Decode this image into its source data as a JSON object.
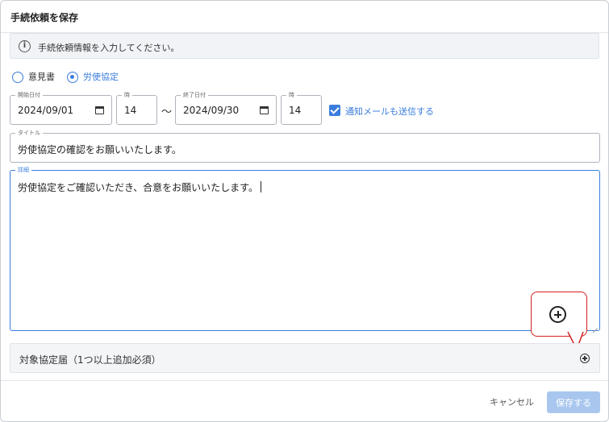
{
  "dialog": {
    "title": "手続依頼を保存",
    "info_text": "手続依頼情報を入力してください。"
  },
  "radios": [
    {
      "label": "意見書",
      "selected": false
    },
    {
      "label": "労使協定",
      "selected": true
    }
  ],
  "start_date": {
    "legend": "開始日付",
    "value": "2024/09/01"
  },
  "start_hour": {
    "legend": "時",
    "value": "14"
  },
  "separator": "～",
  "end_date": {
    "legend": "終了日付",
    "value": "2024/09/30"
  },
  "end_hour": {
    "legend": "時",
    "value": "14"
  },
  "notify": {
    "label": "通知メールも送信する",
    "checked": true
  },
  "title_field": {
    "legend": "タイトル",
    "value": "労使協定の確認をお願いいたします。"
  },
  "detail_field": {
    "legend": "詳細",
    "value": "労使協定をご確認いただき、合意をお願いいたします。"
  },
  "accordion": {
    "label": "対象協定届（1つ以上追加必須）"
  },
  "footer": {
    "cancel_label": "キャンセル",
    "save_label": "保存する"
  },
  "colors": {
    "accent": "#3b7ddd",
    "callout": "#d42020",
    "save_disabled": "#a9c7ee"
  },
  "icons": {
    "info": "info-icon",
    "calendar": "calendar-icon",
    "add": "add-circle-icon"
  }
}
